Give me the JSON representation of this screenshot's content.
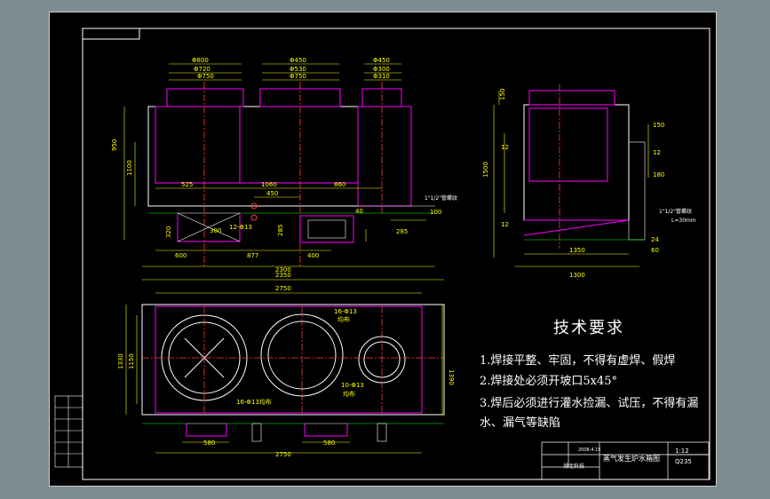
{
  "technical_requirements": {
    "title": "技术要求",
    "items": [
      "1.焊接平整、牢固，不得有虚焊、假焊",
      "2.焊接处必须开坡口5x45°",
      "3.焊后必须进行灌水捡漏、试压，不得有漏",
      "水、漏气等缺陷"
    ]
  },
  "title_block": {
    "drawing_name": "蒸气发生炉水箱图",
    "scale": "1:12",
    "code": "Q235",
    "date": "2008.4.15",
    "school": "湖北科技"
  },
  "dimensions": {
    "top_pipes": [
      "Φ800",
      "Φ720",
      "Φ450",
      "Φ530",
      "Φ750",
      "Φ450",
      "Φ300",
      "Φ310"
    ],
    "front": [
      "950",
      "1100",
      "885",
      "525",
      "1060",
      "860",
      "450",
      "100",
      "40",
      "12-Φ13",
      "600",
      "877",
      "400",
      "2300",
      "320",
      "285",
      "210"
    ],
    "side": [
      "1500",
      "150",
      "12",
      "180",
      "1350",
      "1300",
      "24",
      "60",
      "12"
    ],
    "plan": [
      "2750",
      "2350",
      "1330",
      "1150",
      "580",
      "2750",
      "1390"
    ],
    "hole_notes": [
      "16-Φ13",
      "均布",
      "16-Φ13均布",
      "10-Φ13",
      "均布"
    ],
    "pipe_notes": [
      "1\"1/2\"管螺纹",
      "1\"1/2\"管螺纹",
      "L=30mm"
    ]
  },
  "colors": {
    "frame": "#ffffff",
    "outline": "#ff00ff",
    "dimension": "#ffff00",
    "hidden": "#00ffff",
    "centerline": "#ff3b3b",
    "detail": "#00ff00"
  }
}
